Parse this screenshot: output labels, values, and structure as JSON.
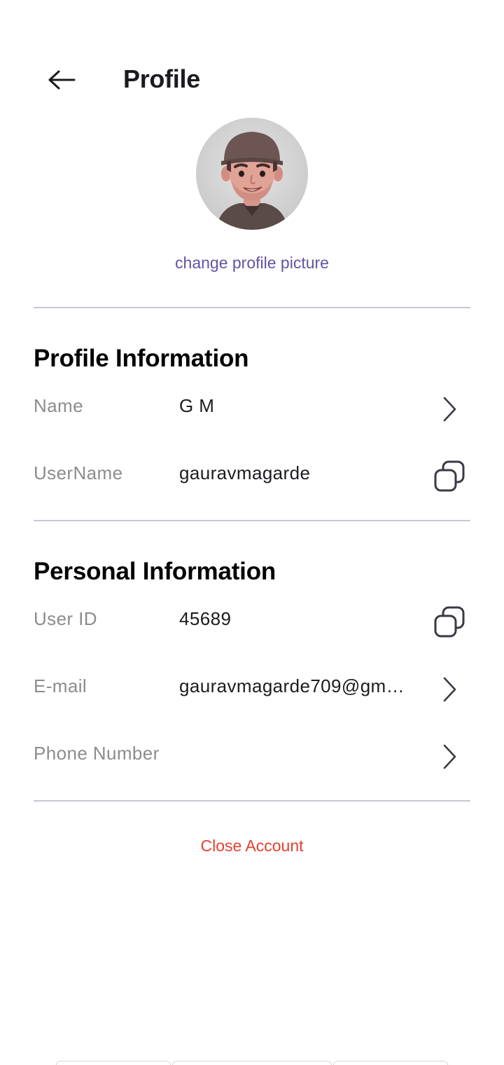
{
  "header": {
    "title": "Profile",
    "back_icon": "arrow-left-icon"
  },
  "avatar": {
    "change_label": "change profile picture"
  },
  "profile_information": {
    "title": "Profile Information",
    "rows": [
      {
        "label": "Name",
        "value": "G M",
        "action_icon": "chevron-right-icon"
      },
      {
        "label": "UserName",
        "value": "gauravmagarde",
        "action_icon": "copy-icon"
      }
    ]
  },
  "personal_information": {
    "title": "Personal Information",
    "rows": [
      {
        "label": "User ID",
        "value": "45689",
        "action_icon": "copy-icon"
      },
      {
        "label": "E-mail",
        "value": "gauravmagarde709@gm…",
        "action_icon": "chevron-right-icon"
      },
      {
        "label": "Phone Number",
        "value": "",
        "action_icon": "chevron-right-icon"
      }
    ]
  },
  "close_account": {
    "label": "Close Account"
  },
  "colors": {
    "accent": "#6452a6",
    "danger": "#e5412f",
    "label": "#8c8c8c",
    "divider": "#c9c6d4"
  }
}
